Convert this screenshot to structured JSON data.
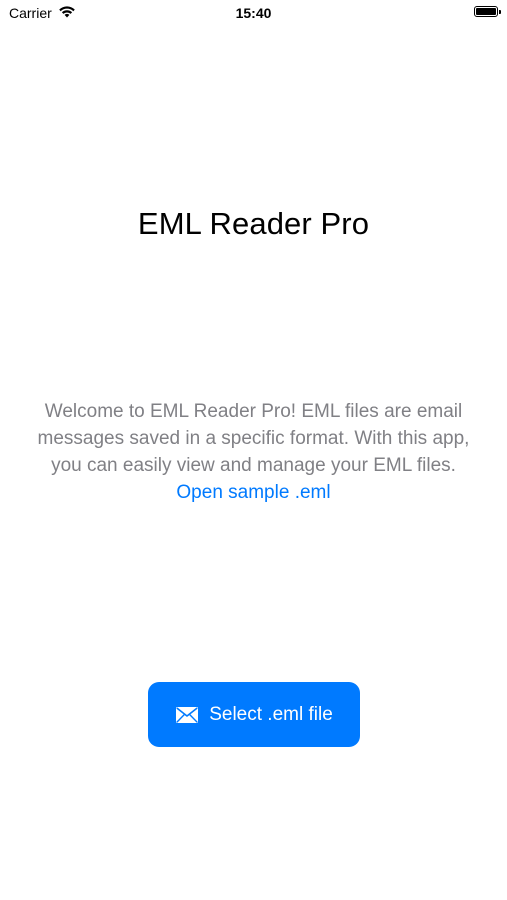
{
  "status_bar": {
    "carrier": "Carrier",
    "time": "15:40",
    "battery_level": 1.0,
    "wifi_icon": "wifi-icon",
    "battery_icon": "battery-icon"
  },
  "main": {
    "title": "EML Reader Pro",
    "welcome_text": "Welcome to EML Reader Pro! EML files are email messages saved in a specific format. With this app, you can easily view and manage your EML files.",
    "sample_link_label": "Open sample .eml",
    "select_button_label": "Select .eml file",
    "select_button_icon": "envelope-icon"
  },
  "colors": {
    "accent": "#007aff",
    "secondary_text": "#808085",
    "background": "#ffffff"
  }
}
